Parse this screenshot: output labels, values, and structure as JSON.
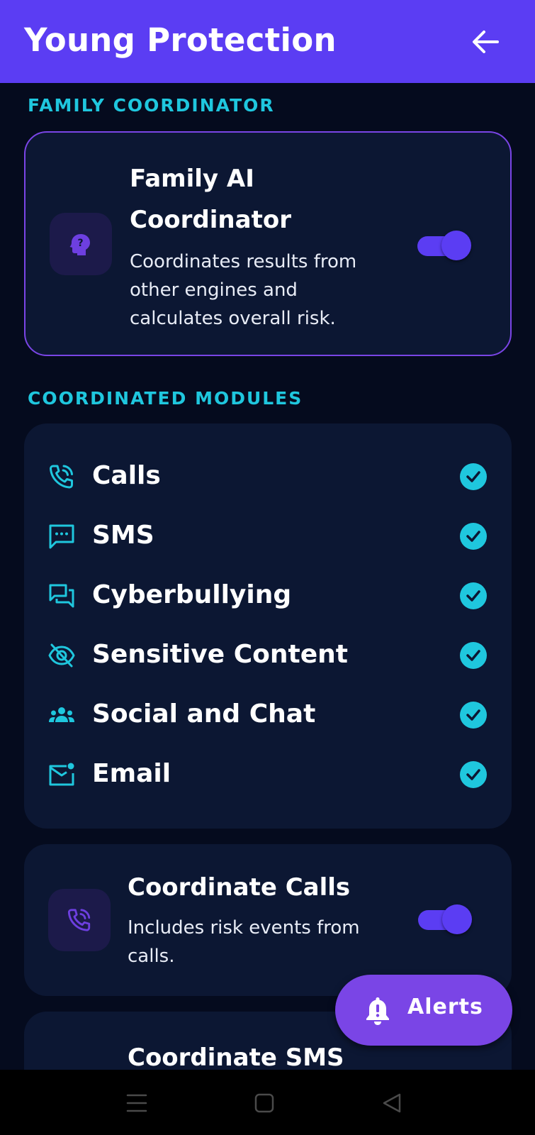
{
  "app_bar": {
    "title": "Young Protection",
    "back_icon": "arrow-left-icon",
    "color": "#5b3df3"
  },
  "coordinator_section": {
    "label": "FAMILY COORDINATOR",
    "card": {
      "icon": "head-question-icon",
      "title_line1": "Family AI",
      "title_line2": "Coordinator",
      "desc_line1": "Coordinates results from",
      "desc_line2": "other engines and",
      "desc_line3": "calculates overall risk.",
      "enabled": true
    }
  },
  "modules_section": {
    "label": "COORDINATED MODULES",
    "modules": [
      {
        "label": "Calls",
        "icon": "phone-call-icon",
        "checked": true
      },
      {
        "label": "SMS",
        "icon": "sms-icon",
        "checked": true
      },
      {
        "label": "Cyberbullying",
        "icon": "chat-bubbles-icon",
        "checked": true
      },
      {
        "label": "Sensitive Content",
        "icon": "eye-off-icon",
        "checked": true
      },
      {
        "label": "Social and Chat",
        "icon": "group-icon",
        "checked": true
      },
      {
        "label": "Email",
        "icon": "mail-badge-icon",
        "checked": true
      }
    ]
  },
  "coordinate_calls": {
    "icon": "phone-call-icon",
    "title": "Coordinate Calls",
    "desc_line1": "Includes risk events from",
    "desc_line2": "calls.",
    "enabled": true
  },
  "coordinate_sms": {
    "title": "Coordinate SMS"
  },
  "fab": {
    "label": "Alerts",
    "icon": "bell-alert-icon",
    "color": "#7a45e6"
  },
  "system_nav": {
    "icons": [
      "menu-icon",
      "home-square-icon",
      "back-triangle-icon"
    ]
  },
  "colors": {
    "background": "#050b1e",
    "card": "#0c1733",
    "accent_cyan": "#1fc7de",
    "accent_purple": "#5b3df3"
  }
}
